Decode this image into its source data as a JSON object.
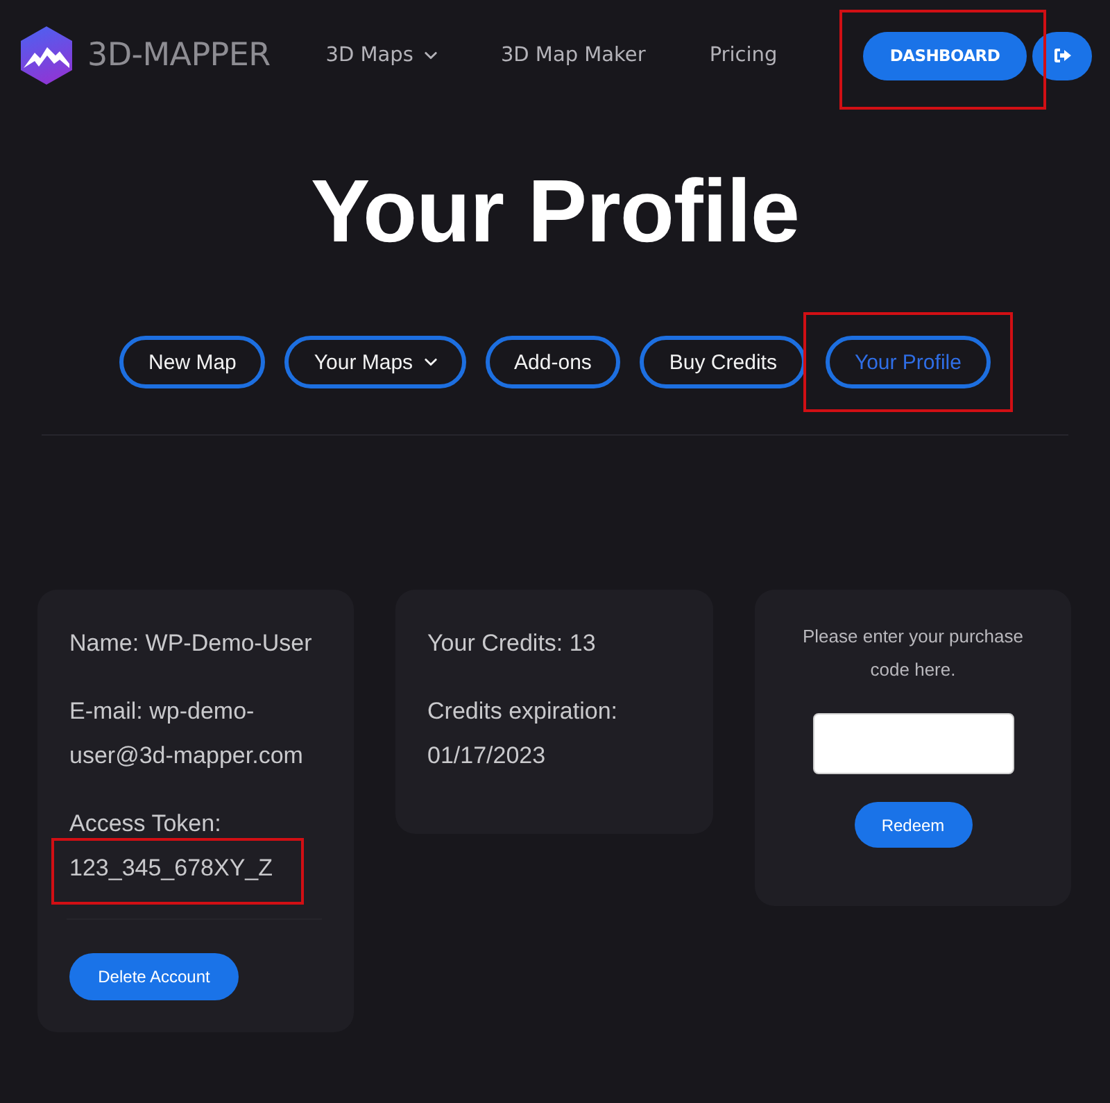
{
  "header": {
    "brand": "3D-MAPPER",
    "nav": [
      {
        "label": "3D Maps",
        "dropdown": true
      },
      {
        "label": "3D Map Maker",
        "dropdown": false
      },
      {
        "label": "Pricing",
        "dropdown": false
      }
    ],
    "dashboard_button": {
      "label": "DASHBOARD",
      "highlighted": true
    }
  },
  "title": "Your Profile",
  "tabs": [
    {
      "label": "New Map",
      "dropdown": false,
      "selected": false,
      "highlighted": false
    },
    {
      "label": "Your Maps",
      "dropdown": true,
      "selected": false,
      "highlighted": false
    },
    {
      "label": "Add-ons",
      "dropdown": false,
      "selected": false,
      "highlighted": false
    },
    {
      "label": "Buy Credits",
      "dropdown": false,
      "selected": false,
      "highlighted": false
    },
    {
      "label": "Your Profile",
      "dropdown": false,
      "selected": true,
      "highlighted": true
    }
  ],
  "account_card": {
    "lines": [
      {
        "kind": "text",
        "text": "Name: WP-Demo-User",
        "highlighted": false
      },
      {
        "kind": "text",
        "text": "E-mail: wp-demo-user@3d-mapper.com",
        "highlighted": false
      },
      {
        "kind": "labeled",
        "label": "Access Token:",
        "value": "123_345_678XY_Z",
        "highlighted": true
      }
    ],
    "button": "Delete Account"
  },
  "credits_card": {
    "lines": [
      "Your Credits: 13",
      "Credits expiration: 01/17/2023"
    ]
  },
  "redeem_card": {
    "prompt": "Please enter your purchase code here.",
    "button": "Redeem"
  }
}
